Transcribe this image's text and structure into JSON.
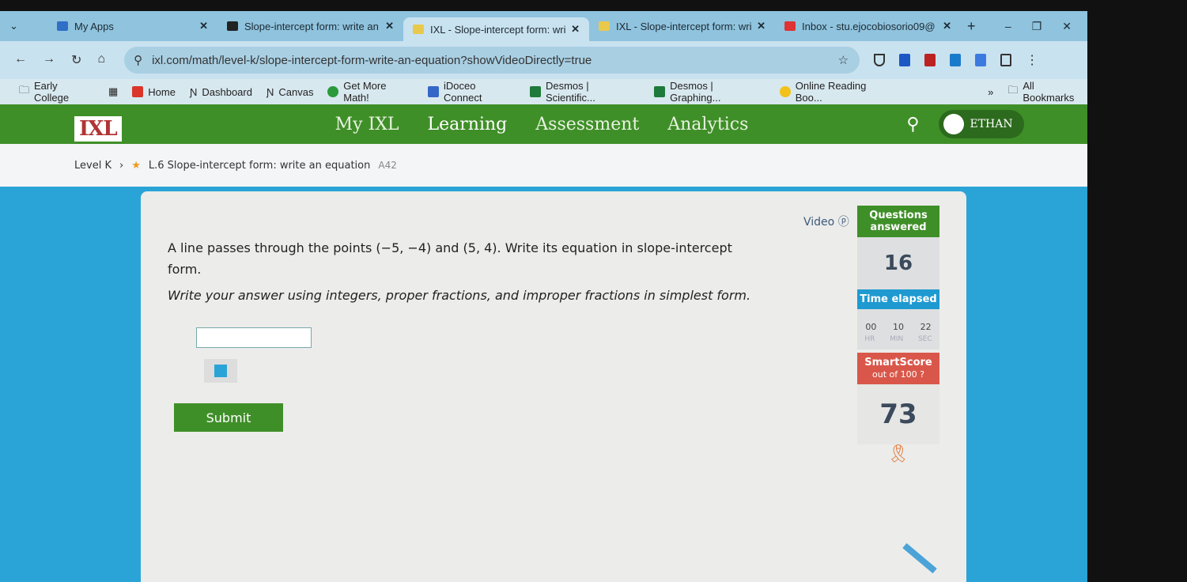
{
  "browser": {
    "tabs": [
      {
        "label": "My Apps",
        "active": false
      },
      {
        "label": "Slope-intercept form: write an",
        "active": false
      },
      {
        "label": "IXL - Slope-intercept form: wri",
        "active": true
      },
      {
        "label": "IXL - Slope-intercept form: wri",
        "active": false
      },
      {
        "label": "Inbox - stu.ejocobiosorio09@",
        "active": false
      }
    ],
    "new_tab": "+",
    "url": "ixl.com/math/level-k/slope-intercept-form-write-an-equation?showVideoDirectly=true",
    "bookmarks": [
      "Early College",
      "Home",
      "Dashboard",
      "Canvas",
      "Get More Math!",
      "iDoceo Connect",
      "Desmos | Scientific...",
      "Desmos | Graphing...",
      "Online Reading Boo..."
    ],
    "all_bookmarks": "All Bookmarks"
  },
  "ixl": {
    "logo": "IXL",
    "nav": [
      "My IXL",
      "Learning",
      "Assessment",
      "Analytics"
    ],
    "user": "ETHAN",
    "breadcrumb": {
      "level": "Level K",
      "skill": "L.6 Slope-intercept form: write an equation",
      "code": "A42"
    },
    "question": "A line passes through the points (−5, −4) and (5, 4). Write its equation in slope-intercept form.",
    "instruction": "Write your answer using integers, proper fractions, and improper fractions in simplest form.",
    "answer_value": "",
    "submit": "Submit",
    "video": "Video",
    "questions_label": "Questions answered",
    "questions_answered": "16",
    "time_label": "Time elapsed",
    "time": {
      "hr": "00",
      "min": "10",
      "sec": "22"
    },
    "time_units": {
      "hr": "HR",
      "min": "MIN",
      "sec": "SEC"
    },
    "smartscore_label": "SmartScore",
    "smartscore_sub": "out of 100",
    "smartscore": "73",
    "colors": {
      "green": "#3f8f28",
      "blue": "#1e9ad1",
      "red": "#d9574a"
    }
  }
}
